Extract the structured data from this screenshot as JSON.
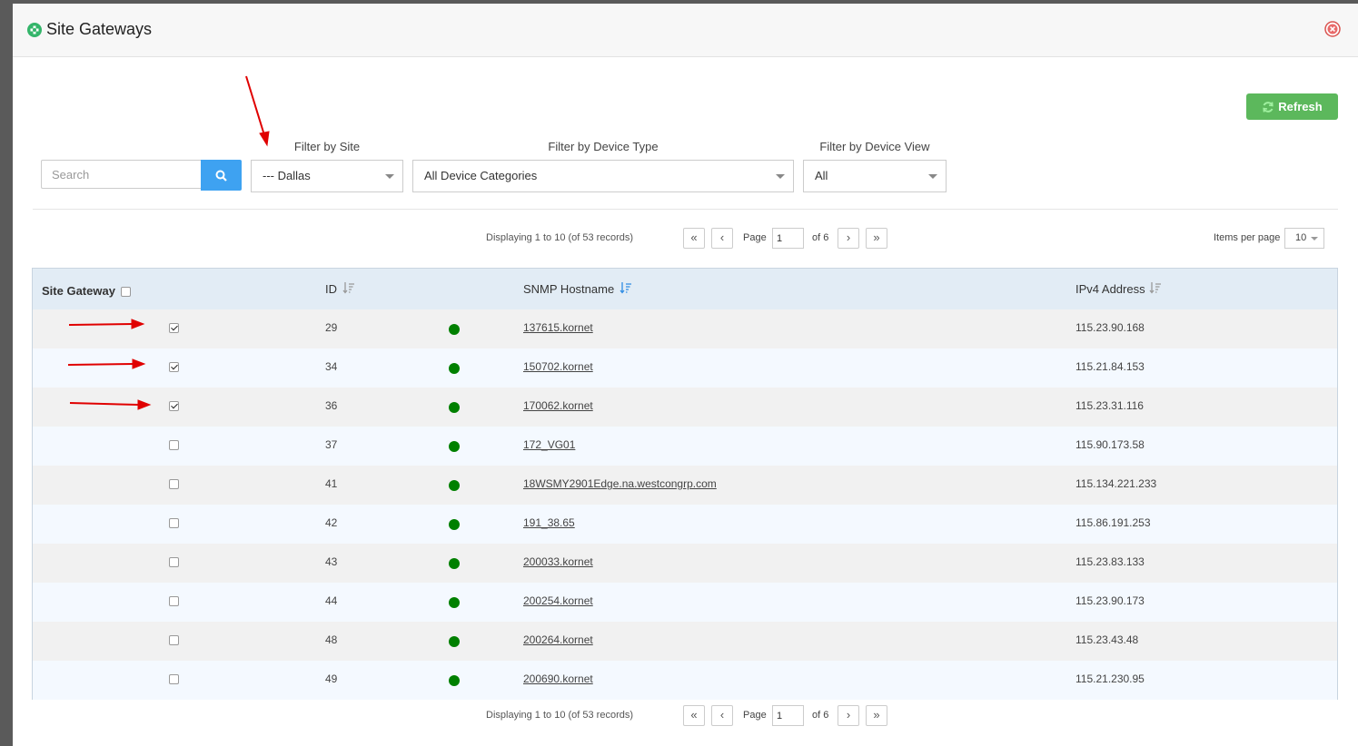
{
  "dialog": {
    "title": "Site Gateways",
    "refresh_label": "Refresh"
  },
  "search": {
    "placeholder": "Search",
    "value": ""
  },
  "filters": {
    "site": {
      "label": "Filter by Site",
      "value": "--- Dallas"
    },
    "device_type": {
      "label": "Filter by Device Type",
      "value": "All Device Categories"
    },
    "device_view": {
      "label": "Filter by Device View",
      "value": "All"
    }
  },
  "pager": {
    "info": "Displaying 1 to 10 (of 53 records)",
    "page_label": "Page",
    "page_value": "1",
    "of_label": "of 6",
    "first": "«",
    "prev": "‹",
    "next": "›",
    "last": "»",
    "items_per_page_label": "Items per page",
    "items_per_page_value": "10"
  },
  "table": {
    "columns": {
      "site_gateway": "Site Gateway",
      "id": "ID",
      "snmp_hostname": "SNMP Hostname",
      "ipv4": "IPv4 Address"
    },
    "rows": [
      {
        "id": "29",
        "hostname": "137615.kornet",
        "ipv4": "115.23.90.168",
        "gateway": true,
        "status": "up"
      },
      {
        "id": "34",
        "hostname": "150702.kornet",
        "ipv4": "115.21.84.153",
        "gateway": true,
        "status": "up"
      },
      {
        "id": "36",
        "hostname": "170062.kornet",
        "ipv4": "115.23.31.116",
        "gateway": true,
        "status": "up"
      },
      {
        "id": "37",
        "hostname": "172_VG01",
        "ipv4": "115.90.173.58",
        "gateway": false,
        "status": "up"
      },
      {
        "id": "41",
        "hostname": "18WSMY2901Edge.na.westcongrp.com",
        "ipv4": "115.134.221.233",
        "gateway": false,
        "status": "up"
      },
      {
        "id": "42",
        "hostname": "191_38.65",
        "ipv4": "115.86.191.253",
        "gateway": false,
        "status": "up"
      },
      {
        "id": "43",
        "hostname": "200033.kornet",
        "ipv4": "115.23.83.133",
        "gateway": false,
        "status": "up"
      },
      {
        "id": "44",
        "hostname": "200254.kornet",
        "ipv4": "115.23.90.173",
        "gateway": false,
        "status": "up"
      },
      {
        "id": "48",
        "hostname": "200264.kornet",
        "ipv4": "115.23.43.48",
        "gateway": false,
        "status": "up"
      },
      {
        "id": "49",
        "hostname": "200690.kornet",
        "ipv4": "115.21.230.95",
        "gateway": false,
        "status": "up"
      }
    ]
  },
  "colors": {
    "refresh_button": "#5cb85c",
    "search_button": "#3ea2f1",
    "status_up": "#008000",
    "header_bg": "#e2ecf5",
    "annotation_arrow": "#e00000"
  },
  "icons": {
    "header": "gateway-icon",
    "close": "close-circle-icon",
    "refresh": "refresh-icon",
    "search": "search-icon",
    "sort": "sort-icon"
  }
}
